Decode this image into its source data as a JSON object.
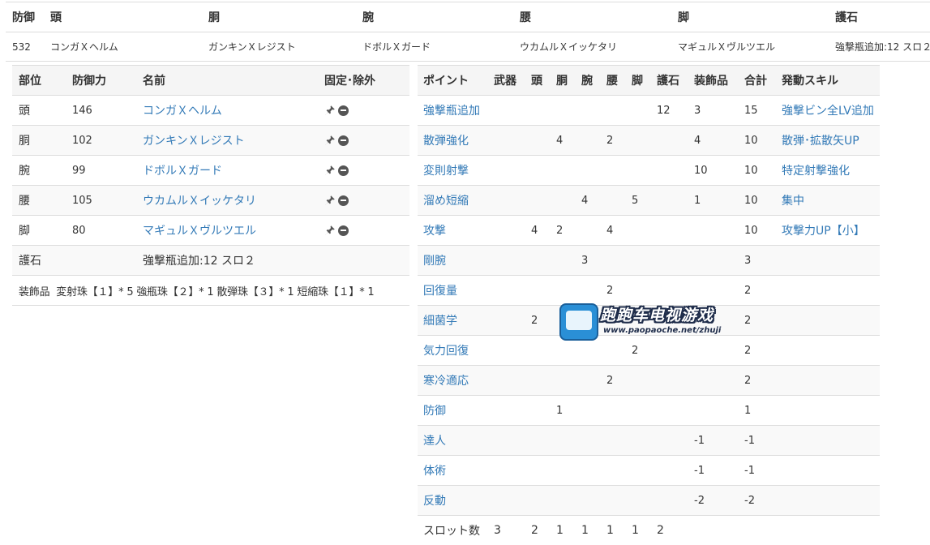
{
  "summary": {
    "headers": [
      "防御",
      "頭",
      "胴",
      "腕",
      "腰",
      "脚",
      "護石"
    ],
    "values": [
      "532",
      "コンガＸヘルム",
      "ガンキンＸレジスト",
      "ドボルＸガード",
      "ウカムルＸイッケタリ",
      "マギュルＸヴルツエル",
      "強撃瓶追加:12 スロ２"
    ]
  },
  "parts": {
    "headers": [
      "部位",
      "防御力",
      "名前",
      "固定･除外"
    ],
    "rows": [
      {
        "part": "頭",
        "defense": "146",
        "name": "コンガＸヘルム"
      },
      {
        "part": "胴",
        "defense": "102",
        "name": "ガンキンＸレジスト"
      },
      {
        "part": "腕",
        "defense": "99",
        "name": "ドボルＸガード"
      },
      {
        "part": "腰",
        "defense": "105",
        "name": "ウカムルＸイッケタリ"
      },
      {
        "part": "脚",
        "defense": "80",
        "name": "マギュルＸヴルツエル"
      }
    ],
    "charm": {
      "label": "護石",
      "value": "強撃瓶追加:12 スロ２"
    },
    "decorations": {
      "label": "装飾品",
      "value": "変射珠【１】* 5 強瓶珠【２】* 1 散弾珠【３】* 1 短縮珠【１】* 1"
    }
  },
  "points": {
    "headers": [
      "ポイント",
      "武器",
      "頭",
      "胴",
      "腕",
      "腰",
      "脚",
      "護石",
      "装飾品",
      "合計",
      "発動スキル"
    ],
    "rows": [
      {
        "skill": "強撃瓶追加",
        "weapon": "",
        "head": "",
        "body": "",
        "arms": "",
        "waist": "",
        "legs": "",
        "charm": "12",
        "deco": "3",
        "total": "15",
        "effect": "強撃ビン全LV追加"
      },
      {
        "skill": "散弾強化",
        "weapon": "",
        "head": "",
        "body": "4",
        "arms": "",
        "waist": "2",
        "legs": "",
        "charm": "",
        "deco": "4",
        "total": "10",
        "effect": "散弾･拡散矢UP"
      },
      {
        "skill": "変則射撃",
        "weapon": "",
        "head": "",
        "body": "",
        "arms": "",
        "waist": "",
        "legs": "",
        "charm": "",
        "deco": "10",
        "total": "10",
        "effect": "特定射撃強化"
      },
      {
        "skill": "溜め短縮",
        "weapon": "",
        "head": "",
        "body": "",
        "arms": "4",
        "waist": "",
        "legs": "5",
        "charm": "",
        "deco": "1",
        "total": "10",
        "effect": "集中"
      },
      {
        "skill": "攻撃",
        "weapon": "",
        "head": "4",
        "body": "2",
        "arms": "",
        "waist": "4",
        "legs": "",
        "charm": "",
        "deco": "",
        "total": "10",
        "effect": "攻撃力UP【小】"
      },
      {
        "skill": "剛腕",
        "weapon": "",
        "head": "",
        "body": "",
        "arms": "3",
        "waist": "",
        "legs": "",
        "charm": "",
        "deco": "",
        "total": "3",
        "effect": ""
      },
      {
        "skill": "回復量",
        "weapon": "",
        "head": "",
        "body": "",
        "arms": "",
        "waist": "2",
        "legs": "",
        "charm": "",
        "deco": "",
        "total": "2",
        "effect": ""
      },
      {
        "skill": "細菌学",
        "weapon": "",
        "head": "2",
        "body": "",
        "arms": "",
        "waist": "",
        "legs": "",
        "charm": "",
        "deco": "",
        "total": "2",
        "effect": ""
      },
      {
        "skill": "気力回復",
        "weapon": "",
        "head": "",
        "body": "",
        "arms": "",
        "waist": "",
        "legs": "2",
        "charm": "",
        "deco": "",
        "total": "2",
        "effect": ""
      },
      {
        "skill": "寒冷適応",
        "weapon": "",
        "head": "",
        "body": "",
        "arms": "",
        "waist": "2",
        "legs": "",
        "charm": "",
        "deco": "",
        "total": "2",
        "effect": ""
      },
      {
        "skill": "防御",
        "weapon": "",
        "head": "",
        "body": "1",
        "arms": "",
        "waist": "",
        "legs": "",
        "charm": "",
        "deco": "",
        "total": "1",
        "effect": ""
      },
      {
        "skill": "達人",
        "weapon": "",
        "head": "",
        "body": "",
        "arms": "",
        "waist": "",
        "legs": "",
        "charm": "",
        "deco": "-1",
        "total": "-1",
        "effect": ""
      },
      {
        "skill": "体術",
        "weapon": "",
        "head": "",
        "body": "",
        "arms": "",
        "waist": "",
        "legs": "",
        "charm": "",
        "deco": "-1",
        "total": "-1",
        "effect": ""
      },
      {
        "skill": "反動",
        "weapon": "",
        "head": "",
        "body": "",
        "arms": "",
        "waist": "",
        "legs": "",
        "charm": "",
        "deco": "-2",
        "total": "-2",
        "effect": ""
      }
    ],
    "slots": {
      "label": "スロット数",
      "weapon": "3",
      "head": "2",
      "body": "1",
      "arms": "1",
      "waist": "1",
      "legs": "1",
      "charm": "2"
    }
  },
  "watermark": {
    "title": "跑跑车电视游戏",
    "url": "www.paopaoche.net/zhuji"
  },
  "colors": {
    "link": "#337ab7",
    "header_bg": "#f5f5f5",
    "stripe_bg": "#f9f9f9",
    "border": "#dddddd"
  },
  "icons": {
    "pin": "pin-icon",
    "exclude": "minus-circle-icon"
  }
}
